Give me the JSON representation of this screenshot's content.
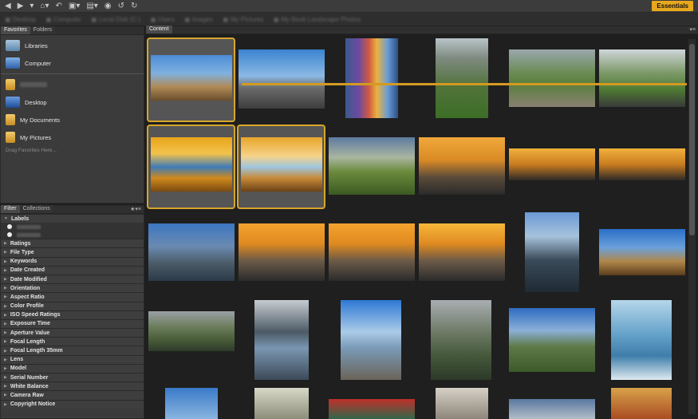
{
  "toolbar": {
    "essentials_label": "Essentials"
  },
  "favorites_panel": {
    "tabs": [
      "Favorites",
      "Folders"
    ],
    "items": [
      {
        "label": "Libraries",
        "icon": "libraries-icon",
        "color": "#7da4c4"
      },
      {
        "label": "Computer",
        "icon": "computer-icon",
        "color": "#5c8fd1"
      },
      {
        "label": "",
        "icon": "user-folder-icon",
        "color": "#e3b24a"
      },
      {
        "label": "Desktop",
        "icon": "desktop-icon",
        "color": "#3b6ec2"
      },
      {
        "label": "My Documents",
        "icon": "documents-folder-icon",
        "color": "#e3b24a"
      },
      {
        "label": "My Pictures",
        "icon": "pictures-folder-icon",
        "color": "#e3b24a"
      }
    ],
    "hint": "Drag Favorites Here..."
  },
  "filter_panel": {
    "tabs": [
      "Filter",
      "Collections"
    ],
    "first_category": "Labels",
    "categories": [
      "Ratings",
      "File Type",
      "Keywords",
      "Date Created",
      "Date Modified",
      "Orientation",
      "Aspect Ratio",
      "Color Profile",
      "ISO Speed Ratings",
      "Exposure Time",
      "Aperture Value",
      "Focal Length",
      "Focal Length 35mm",
      "Lens",
      "Model",
      "Serial Number",
      "White Balance",
      "Camera Raw",
      "Copyright Notice"
    ]
  },
  "content_panel": {
    "tab_label": "Content"
  },
  "accent_color": "#d7a62b"
}
